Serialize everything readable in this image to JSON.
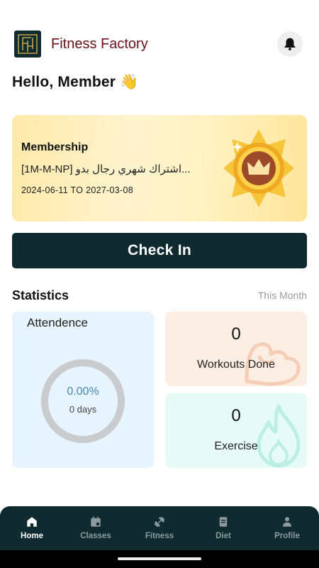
{
  "header": {
    "app_name": "Fitness Factory"
  },
  "greeting": {
    "text": "Hello, Member",
    "emoji": "👋"
  },
  "membership": {
    "title": "Membership",
    "plan": "[1M-M-NP] اشتراك شهري رجال بدو...",
    "dates": "2024-06-11 TO 2027-03-08"
  },
  "checkin": {
    "label": "Check In"
  },
  "statistics": {
    "title": "Statistics",
    "period": "This Month",
    "attendance": {
      "label": "Attendence",
      "percent": "0.00%",
      "days": "0 days",
      "fraction": 0
    },
    "workouts": {
      "value": "0",
      "label": "Workouts Done"
    },
    "exercise": {
      "value": "0",
      "label": "Exercise"
    }
  },
  "nav": {
    "items": [
      {
        "label": "Home",
        "icon": "home-icon",
        "active": true
      },
      {
        "label": "Classes",
        "icon": "calendar-icon",
        "active": false
      },
      {
        "label": "Fitness",
        "icon": "dumbbell-icon",
        "active": false
      },
      {
        "label": "Diet",
        "icon": "notepad-icon",
        "active": false
      },
      {
        "label": "Profile",
        "icon": "person-icon",
        "active": false
      }
    ]
  },
  "colors": {
    "primary": "#0f2b2f",
    "brand_text": "#6b1018",
    "accent_blue": "#4a88bd"
  }
}
